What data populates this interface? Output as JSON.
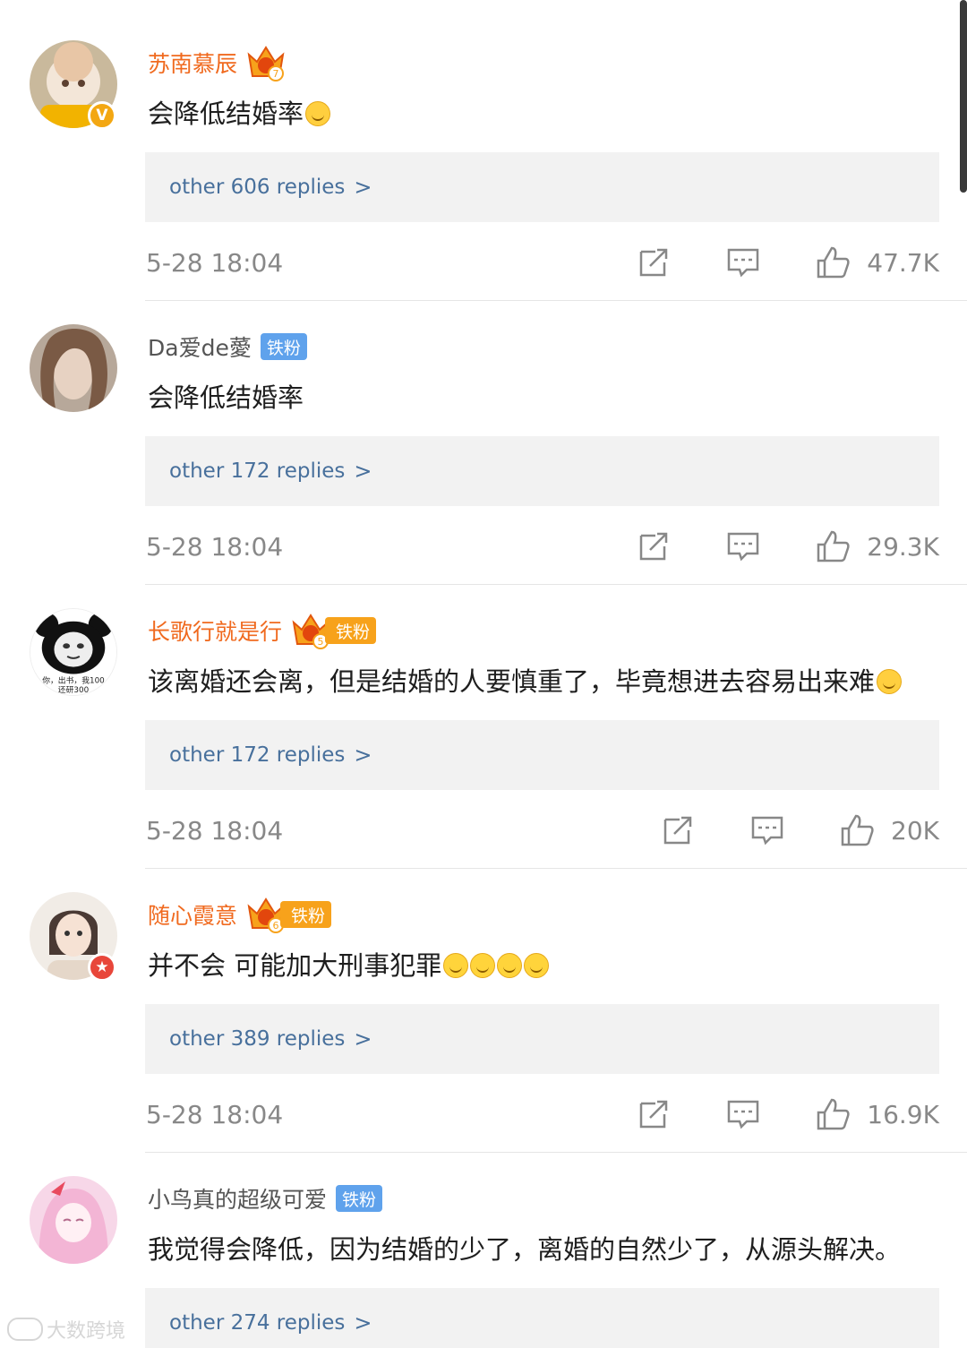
{
  "comments": [
    {
      "username": "苏南慕辰",
      "name_style": "vip",
      "crown_level": "7",
      "fan_badge": "",
      "text": "会降低结婚率",
      "emojis": 1,
      "replies": "other 606 replies",
      "time": "5-28 18:04",
      "likes": "47.7K",
      "verified": "V"
    },
    {
      "username": "Da爱de薆",
      "name_style": "normal",
      "crown_level": "",
      "fan_badge": "铁粉",
      "text": "会降低结婚率",
      "emojis": 0,
      "replies": "other 172 replies",
      "time": "5-28 18:04",
      "likes": "29.3K",
      "verified": ""
    },
    {
      "username": "长歌行就是行",
      "name_style": "vip",
      "crown_level": "5",
      "fan_badge": "铁粉",
      "text": "该离婚还会离，但是结婚的人要慎重了，毕竟想进去容易出来难",
      "emojis": 1,
      "replies": "other 172 replies",
      "time": "5-28 18:04",
      "likes": "20K",
      "verified": ""
    },
    {
      "username": "随心霞意",
      "name_style": "vip",
      "crown_level": "6",
      "fan_badge": "铁粉",
      "text": "并不会 可能加大刑事犯罪",
      "emojis": 4,
      "replies": "other 389 replies",
      "time": "5-28 18:04",
      "likes": "16.9K",
      "verified": "★"
    },
    {
      "username": "小鸟真的超级可爱",
      "name_style": "normal",
      "crown_level": "",
      "fan_badge": "铁粉",
      "text": "我觉得会降低，因为结婚的少了，离婚的自然少了，从源头解决。",
      "emojis": 0,
      "replies": "other 274 replies",
      "time": "",
      "likes": "",
      "verified": ""
    }
  ],
  "avatar_text": {
    "panda_caption": "你，出书，我100",
    "panda_caption2": "还研300"
  },
  "watermark": "大数跨境",
  "colors": {
    "vip_name": "#f06a1f",
    "fan_badge": "#5fa2ec",
    "reply_link": "#48709c",
    "meta_gray": "#888888"
  }
}
